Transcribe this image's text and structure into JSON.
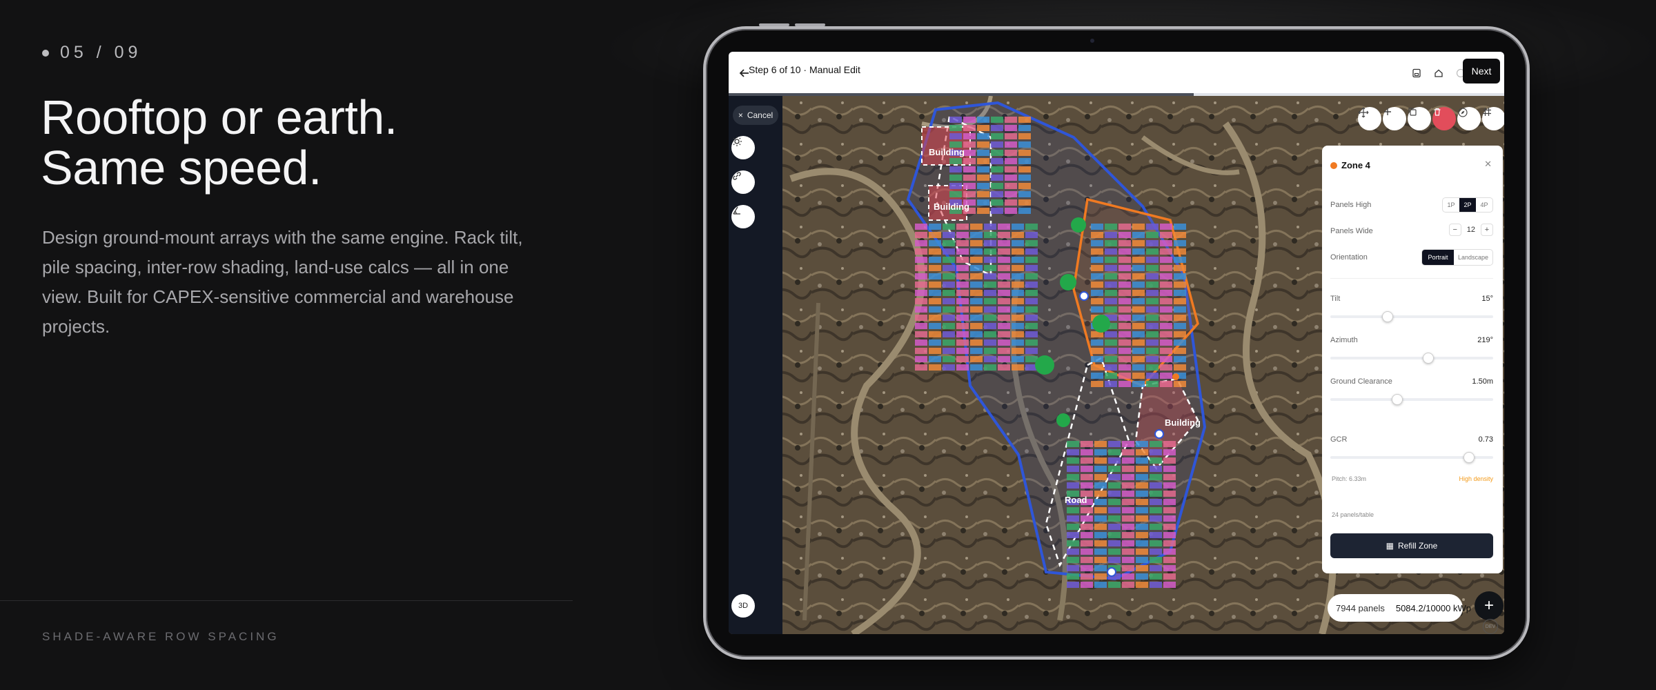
{
  "slide": {
    "index": "05 / 09"
  },
  "headline": {
    "line1": "Rooftop or earth.",
    "line2": "Same speed."
  },
  "description": "Design ground-mount arrays with the same engine. Rack tilt, pile spacing, inter-row shading, land-use calcs — all in one view. Built for CAPEX-sensitive commercial and warehouse projects.",
  "footer_label": "SHADE-AWARE ROW SPACING",
  "app": {
    "topbar": {
      "back_icon": "arrow-left-icon",
      "title": "Step 6 of 10 · Manual Edit",
      "next_label": "Next",
      "progress": 0.6
    },
    "left_tools": {
      "cancel_label": "Cancel",
      "three_d_label": "3D",
      "tools": [
        "sun-icon",
        "link-icon",
        "angle-icon"
      ]
    },
    "map_tools": [
      "move-icon",
      "add-icon",
      "copy-icon",
      "delete-icon",
      "compass-icon",
      "grid-icon"
    ],
    "map_labels": {
      "building1": "Building",
      "building2": "Building",
      "building3": "Building",
      "road": "Road"
    },
    "zone_panel": {
      "title": "Zone 4",
      "zone_color": "#f07a22",
      "panels_high": {
        "label": "Panels High",
        "options": [
          "1P",
          "2P",
          "4P"
        ],
        "selected": "2P"
      },
      "panels_wide": {
        "label": "Panels Wide",
        "value": "12",
        "minus": "−",
        "plus": "+"
      },
      "orientation": {
        "label": "Orientation",
        "options": [
          "Portrait",
          "Landscape"
        ],
        "selected": "Portrait"
      },
      "tilt": {
        "label": "Tilt",
        "value": "15°",
        "level": 0.35
      },
      "azimuth": {
        "label": "Azimuth",
        "value": "219°",
        "level": 0.6
      },
      "ground_clearance": {
        "label": "Ground Clearance",
        "value": "1.50m",
        "level": 0.41
      },
      "gcr": {
        "label": "GCR",
        "value": "0.73",
        "level": 0.85
      },
      "pitch": "Pitch: 6.33m",
      "density": "High density",
      "panels_per_table": "24 panels/table",
      "refill_label": "Refill Zone"
    },
    "stats": {
      "panels": "7944 panels",
      "capacity": "5084.2/10000 kWp"
    },
    "fab_label": "+",
    "dev_badge": "DEV"
  }
}
